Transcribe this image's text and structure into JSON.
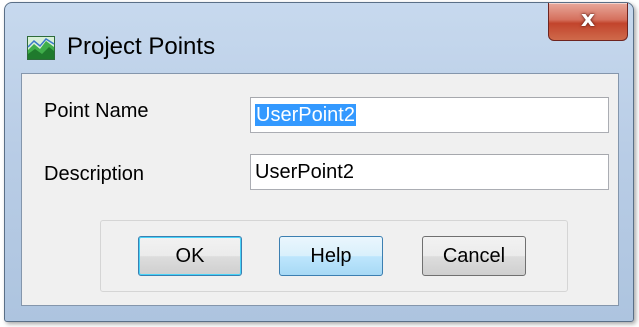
{
  "window": {
    "title": "Project Points",
    "close_label": "x",
    "icon": "app-chart-icon"
  },
  "form": {
    "point_name": {
      "label": "Point Name",
      "value": "UserPoint2",
      "value_selected": true
    },
    "description": {
      "label": "Description",
      "value": "UserPoint2"
    }
  },
  "buttons": {
    "ok_label": "OK",
    "help_label": "Help",
    "cancel_label": "Cancel"
  },
  "colors": {
    "selection": "#3399ff",
    "close_button": "#c2442c",
    "title_bar": "#b9cde6",
    "client_bg": "#f0f0f0"
  }
}
